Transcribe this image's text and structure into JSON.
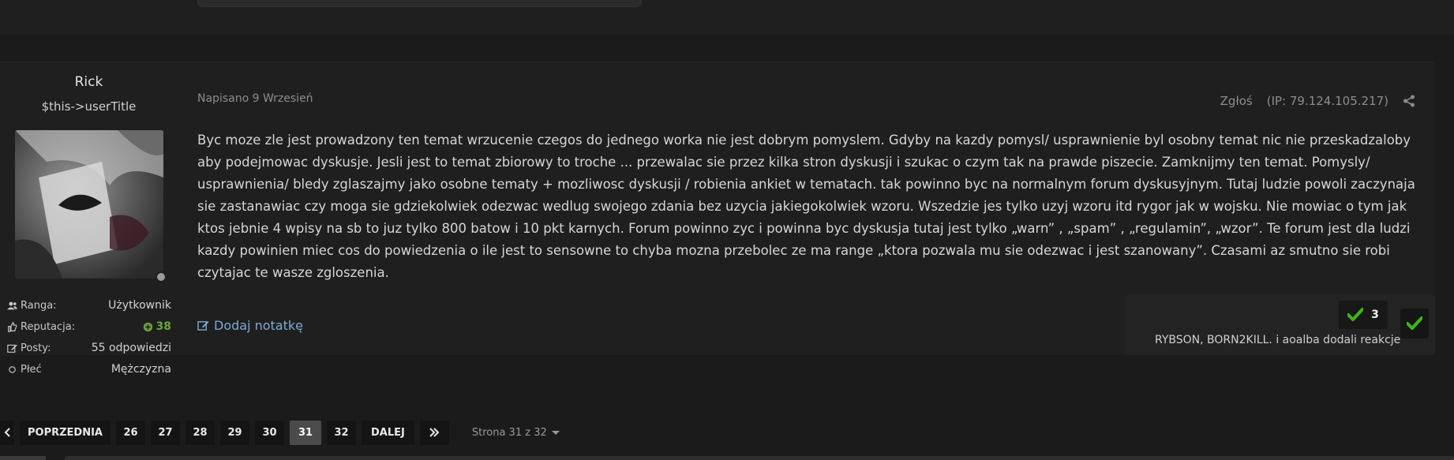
{
  "author": {
    "name": "Rick",
    "title": "$this->userTitle",
    "stats": [
      {
        "icon": "users-icon",
        "label": "Ranga:",
        "value": "Użytkownik"
      },
      {
        "icon": "thumbs-up-icon",
        "label": "Reputacja:",
        "value": "38",
        "value_icon": "plus-circle-icon"
      },
      {
        "icon": "edit-icon",
        "label": "Posty:",
        "value": "55 odpowiedzi"
      },
      {
        "icon": "circle-icon",
        "label": "Płeć",
        "value": "Mężczyzna"
      }
    ]
  },
  "post": {
    "date": "Napisano 9 Wrzesień",
    "report_label": "Zgłoś",
    "ip": "(IP: 79.124.105.217)",
    "body": "Byc moze zle jest prowadzony ten temat wrzucenie czegos do jednego worka nie jest dobrym pomyslem. Gdyby na kazdy pomysl/ usprawnienie byl osobny temat nic nie przeskadzaloby aby podejmowac dyskusje. Jesli jest to temat zbiorowy to troche ... przewalac sie przez kilka stron dyskusji i szukac o czym tak na prawde piszecie. Zamknijmy ten temat. Pomysly/ usprawnienia/ bledy zglaszajmy jako osobne tematy + mozliwosc dyskusji / robienia ankiet w tematach. tak powinno byc na normalnym forum dyskusyjnym. Tutaj ludzie powoli zaczynaja sie zastanawiac czy moga sie gdziekolwiek odezwac wedlug swojego zdania bez uzycia jakiegokolwiek wzoru. Wszedzie jes tylko uzyj wzoru itd rygor jak w wojsku. Nie mowiac o tym jak ktos jebnie 4 wpisy na sb to juz tylko 800 batow i 10 pkt karnych. Forum powinno zyc i powinna byc dyskusja tutaj jest tylko „warn” , „spam” , „regulamin”, „wzor”. Te forum jest dla ludzi kazdy powinien miec cos do powiedzenia o ile jest to sensowne to chyba mozna przebolec ze ma range „ktora pozwala mu sie odezwac i jest szanowany”. Czasami az smutno sie robi czytajac te wasze zgloszenia.",
    "add_note": "Dodaj notatkę",
    "reactions": {
      "count": "3",
      "names": "RYBSON, BORN2KILL. i aoalba dodali reakcje"
    }
  },
  "pagination": {
    "prev": "POPRZEDNIA",
    "pages": [
      "26",
      "27",
      "28",
      "29",
      "30",
      "31",
      "32"
    ],
    "current": "31",
    "next": "DALEJ",
    "summary": "Strona 31 z 32"
  },
  "colors": {
    "accent_link": "#7ea9d6",
    "reputation": "#6aa33a",
    "check": "#3fb618"
  }
}
